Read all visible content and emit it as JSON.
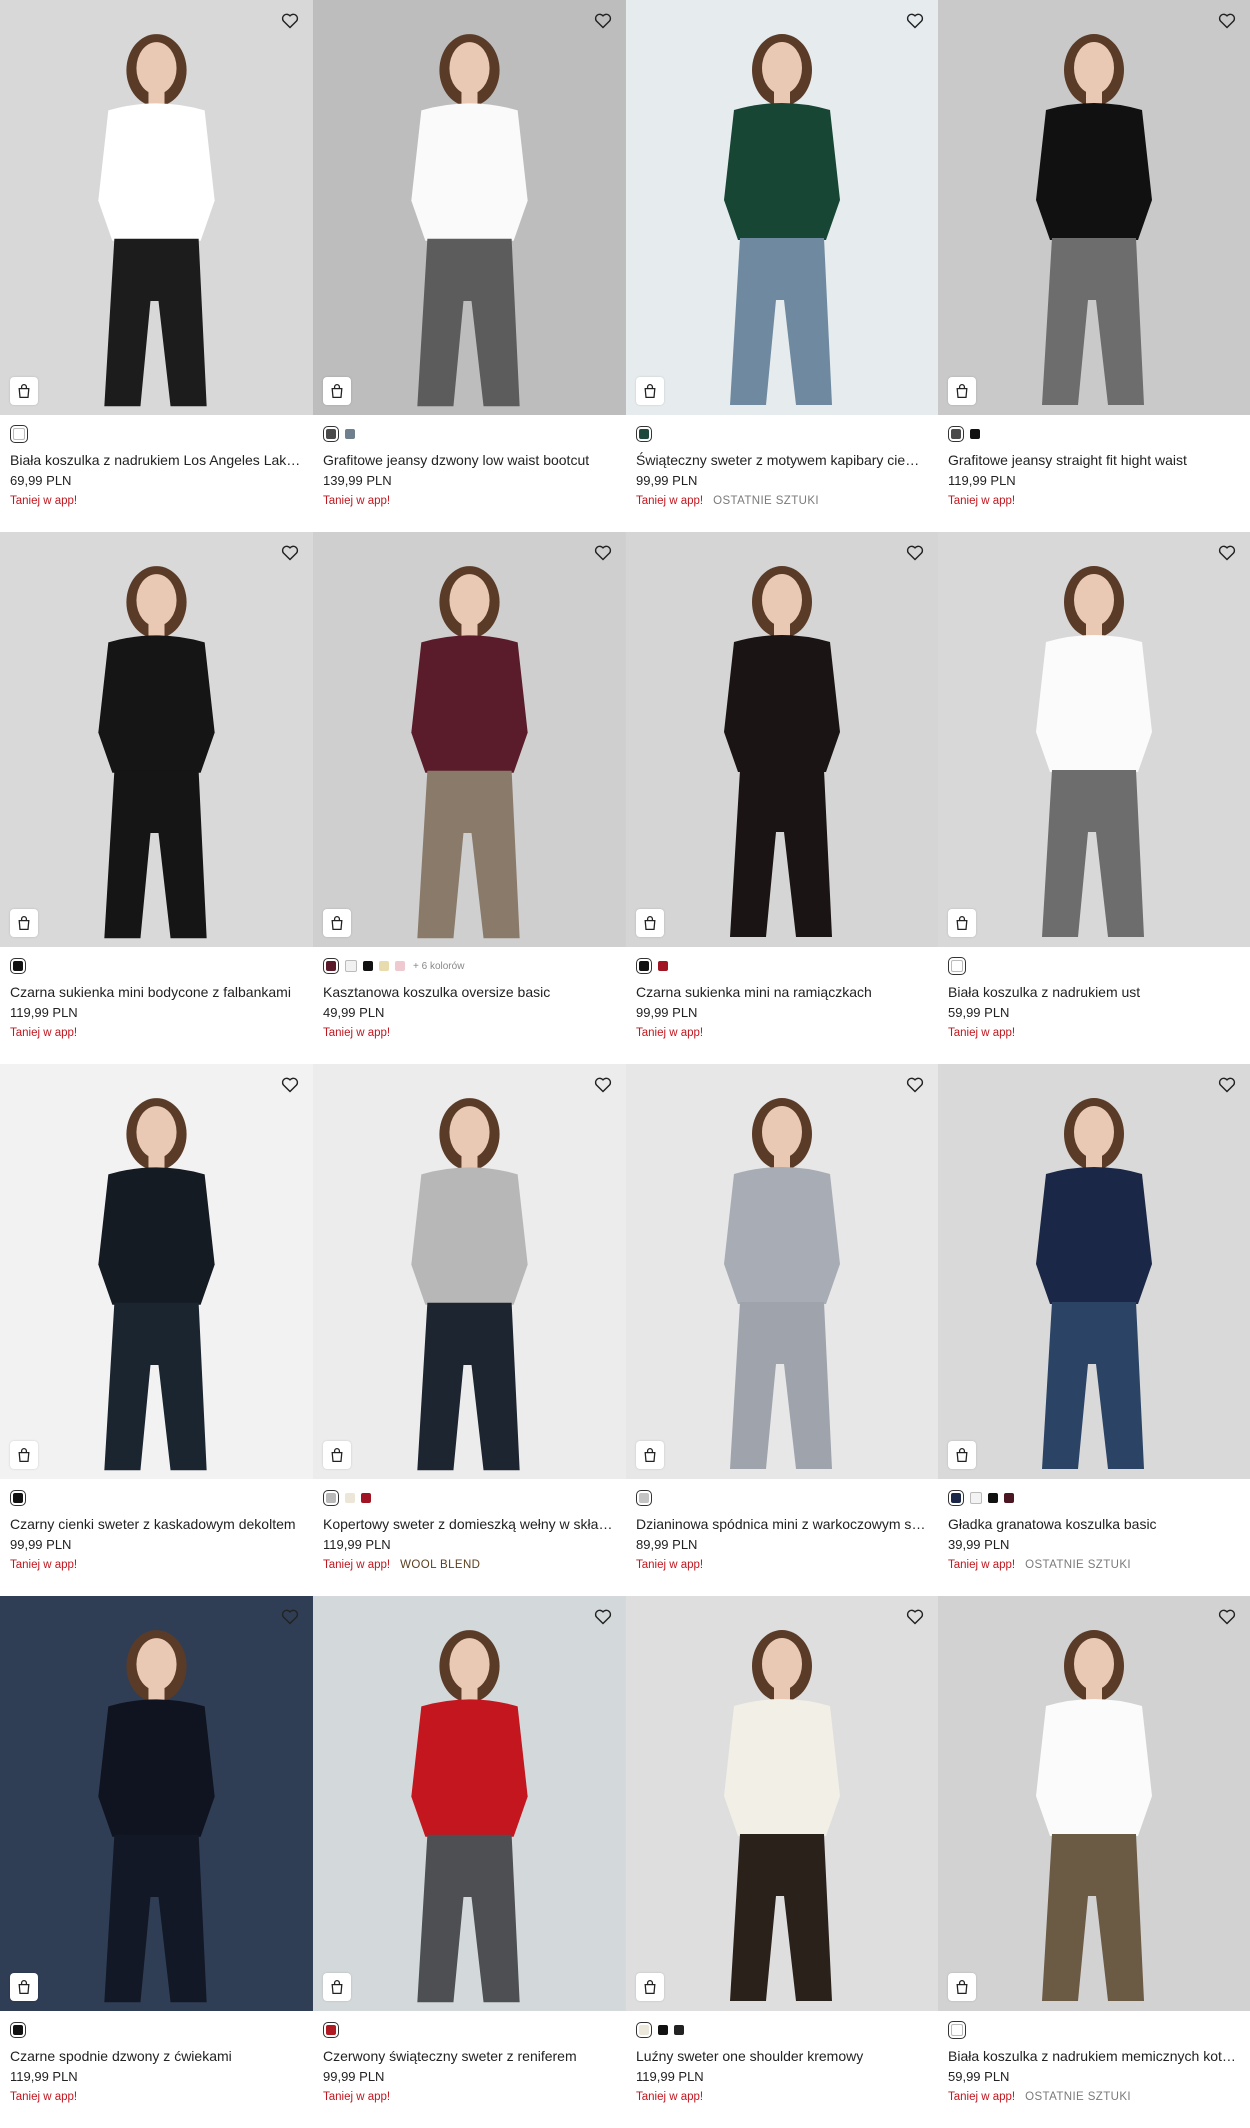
{
  "products": [
    {
      "name": "Biała koszulka z nadrukiem Los Angeles Lakers",
      "price": "69,99 PLN",
      "promo": "Taniej w app!",
      "extra": "",
      "swatches": [
        "#ffffff"
      ],
      "more": "",
      "bg": "#d8d8d8",
      "top": "#ffffff",
      "bottom": "#1c1c1c"
    },
    {
      "name": "Grafitowe jeansy dzwony low waist bootcut",
      "price": "139,99 PLN",
      "promo": "Taniej w app!",
      "extra": "",
      "swatches": [
        "#4a4a4a",
        "#6f7f8e"
      ],
      "more": "",
      "bg": "#bdbdbd",
      "top": "#fafafa",
      "bottom": "#5c5c5c"
    },
    {
      "name": "Świąteczny sweter z motywem kapibary ciemnozielony",
      "price": "99,99 PLN",
      "promo": "Taniej w app!",
      "extra": "OSTATNIE SZTUKI",
      "swatches": [
        "#1d4a3c"
      ],
      "more": "",
      "bg": "#e6ecee",
      "top": "#174635",
      "bottom": "#6f8aa0"
    },
    {
      "name": "Grafitowe jeansy straight fit hight waist",
      "price": "119,99 PLN",
      "promo": "Taniej w app!",
      "extra": "",
      "swatches": [
        "#4a4a4a",
        "#111111"
      ],
      "more": "",
      "bg": "#c9c9c9",
      "top": "#111111",
      "bottom": "#6d6d6d"
    },
    {
      "name": "Czarna sukienka mini bodycone z falbankami",
      "price": "119,99 PLN",
      "promo": "Taniej w app!",
      "extra": "",
      "swatches": [
        "#111111"
      ],
      "more": "",
      "bg": "#d9d9d9",
      "top": "#151515",
      "bottom": "#151515"
    },
    {
      "name": "Kasztanowa koszulka oversize basic",
      "price": "49,99 PLN",
      "promo": "Taniej w app!",
      "extra": "",
      "swatches": [
        "#5a1a2a",
        "#f1f1f1",
        "#111111",
        "#e8dcae",
        "#eec9cf"
      ],
      "more": "+ 6 kolorów",
      "bg": "#cfcfcf",
      "top": "#5a1c2b",
      "bottom": "#8a7a6a"
    },
    {
      "name": "Czarna sukienka mini na ramiączkach",
      "price": "99,99 PLN",
      "promo": "Taniej w app!",
      "extra": "",
      "swatches": [
        "#111111",
        "#a01424"
      ],
      "more": "",
      "bg": "#d5d5d5",
      "top": "#1b1414",
      "bottom": "#1b1414"
    },
    {
      "name": "Biała koszulka z nadrukiem ust",
      "price": "59,99 PLN",
      "promo": "Taniej w app!",
      "extra": "",
      "swatches": [
        "#ffffff"
      ],
      "more": "",
      "bg": "#d8d8d8",
      "top": "#fbfbfb",
      "bottom": "#6d6d6d"
    },
    {
      "name": "Czarny cienki sweter z kaskadowym dekoltem",
      "price": "99,99 PLN",
      "promo": "Taniej w app!",
      "extra": "",
      "swatches": [
        "#111111"
      ],
      "more": "",
      "bg": "#f2f2f2",
      "top": "#151b22",
      "bottom": "#1b2530"
    },
    {
      "name": "Kopertowy sweter z domieszką wełny w składzie",
      "price": "119,99 PLN",
      "promo": "Taniej w app!",
      "extra": "WOOL BLEND",
      "swatches": [
        "#b9b9b9",
        "#ece6d8",
        "#a01424"
      ],
      "more": "",
      "bg": "#ececec",
      "top": "#b7b7b7",
      "bottom": "#1d2530"
    },
    {
      "name": "Dzianinowa spódnica mini z warkoczowym splotem",
      "price": "89,99 PLN",
      "promo": "Taniej w app!",
      "extra": "",
      "swatches": [
        "#c4c4c4"
      ],
      "more": "",
      "bg": "#e7e7e7",
      "top": "#a8adb5",
      "bottom": "#9fa4ac"
    },
    {
      "name": "Gładka granatowa koszulka basic",
      "price": "39,99 PLN",
      "promo": "Taniej w app!",
      "extra": "OSTATNIE SZTUKI",
      "swatches": [
        "#1b2748",
        "#f3f3f3",
        "#111111",
        "#4b1522"
      ],
      "more": "",
      "bg": "#d9d9d9",
      "top": "#1a2746",
      "bottom": "#2b4466"
    },
    {
      "name": "Czarne spodnie dzwony z ćwiekami",
      "price": "119,99 PLN",
      "promo": "Taniej w app!",
      "extra": "",
      "swatches": [
        "#111111"
      ],
      "more": "",
      "bg": "#2f3e55",
      "top": "#0f1420",
      "bottom": "#121826"
    },
    {
      "name": "Czerwony świąteczny sweter z reniferem",
      "price": "99,99 PLN",
      "promo": "Taniej w app!",
      "extra": "",
      "swatches": [
        "#b01a22"
      ],
      "more": "",
      "bg": "#d3d9da",
      "top": "#c3161f",
      "bottom": "#4d4f52"
    },
    {
      "name": "Luźny sweter one shoulder kremowy",
      "price": "119,99 PLN",
      "promo": "Taniej w app!",
      "extra": "",
      "swatches": [
        "#ede8dc",
        "#111111",
        "#222222"
      ],
      "more": "",
      "bg": "#dedede",
      "top": "#f2efe6",
      "bottom": "#2b211b"
    },
    {
      "name": "Biała koszulka z nadrukiem memicznych kotków",
      "price": "59,99 PLN",
      "promo": "Taniej w app!",
      "extra": "OSTATNIE SZTUKI",
      "swatches": [
        "#ffffff"
      ],
      "more": "",
      "bg": "#d2d2d2",
      "top": "#fbfbfb",
      "bottom": "#6b5a44"
    }
  ]
}
